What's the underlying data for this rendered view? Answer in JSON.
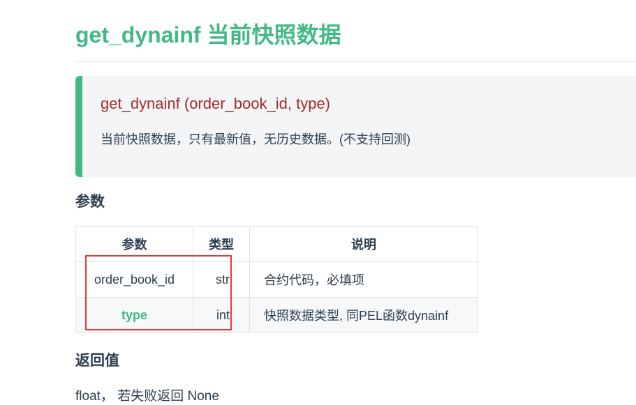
{
  "page": {
    "title": "get_dynainf 当前快照数据"
  },
  "callout": {
    "signature": "get_dynainf (order_book_id, type)",
    "description": "当前快照数据，只有最新值，无历史数据。(不支持回测)"
  },
  "params": {
    "heading": "参数",
    "columns": [
      "参数",
      "类型",
      "说明"
    ],
    "rows": [
      {
        "name": "order_book_id",
        "type": "str",
        "desc": "合约代码，必填项"
      },
      {
        "name": "type",
        "type": "int",
        "desc": "快照数据类型, 同PEL函数dynainf"
      }
    ]
  },
  "returns": {
    "heading": "返回值",
    "text": "float， 若失败返回 None"
  },
  "colors": {
    "accent": "#42b983",
    "signature": "#a52a2a",
    "annotation": "#e53935"
  }
}
